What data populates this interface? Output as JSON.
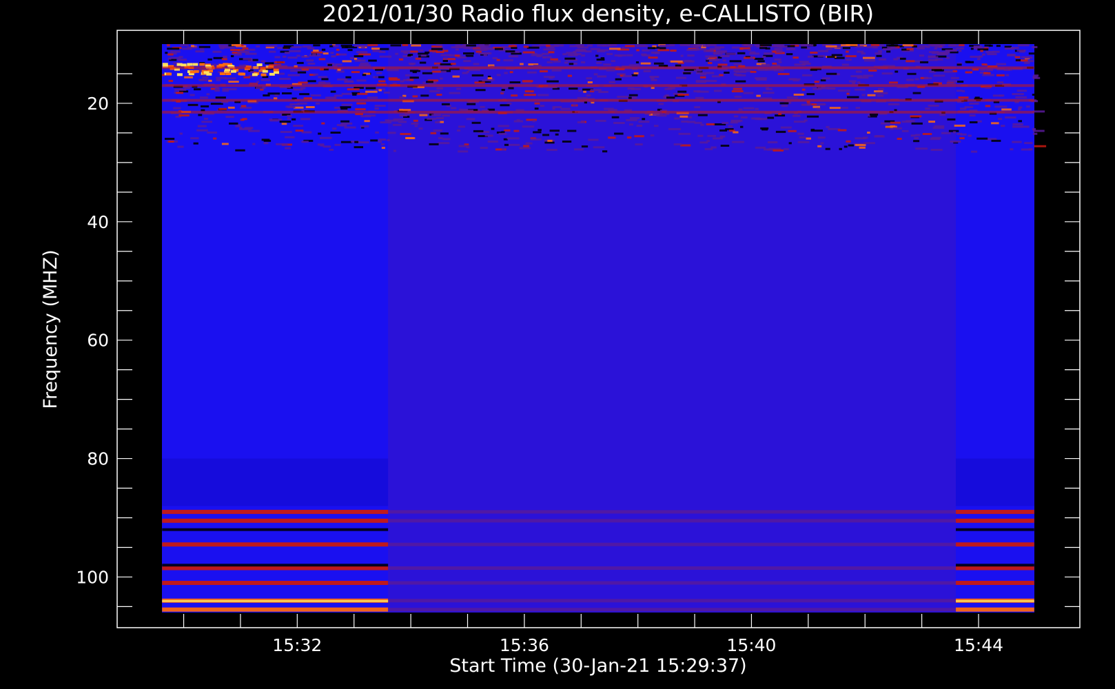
{
  "chart_data": {
    "type": "heatmap",
    "title": "2021/01/30  Radio flux density, e-CALLISTO (BIR)",
    "xlabel": "Start Time (30-Jan-21 15:29:37)",
    "ylabel": "Frequency (MHZ)",
    "x_ticks": [
      "15:32",
      "15:36",
      "15:40",
      "15:44"
    ],
    "y_ticks": [
      "20",
      "40",
      "60",
      "80",
      "100"
    ],
    "y_tick_values": [
      20,
      40,
      60,
      80,
      100
    ],
    "x_tick_minutes": [
      32,
      36,
      40,
      44
    ],
    "x_range_minutes": [
      29.617,
      44.983
    ],
    "y_range": [
      10,
      106
    ],
    "y_axis_inverted": true,
    "colormap": "black-red-orange-yellow-white over blue background",
    "segments": [
      {
        "name": "left",
        "t_start_minutes": 29.62,
        "t_end_minutes": 33.6
      },
      {
        "name": "middle",
        "t_start_minutes": 33.6,
        "t_end_minutes": 43.6
      },
      {
        "name": "right",
        "t_start_minutes": 43.6,
        "t_end_minutes": 44.98
      }
    ],
    "bright_bands_mhz": [
      14.0,
      17.0,
      19.5,
      21.5,
      89.0,
      90.5,
      94.5,
      98.5,
      101.0,
      104.0,
      105.5
    ]
  },
  "colors": {
    "background": "#000000",
    "frame": "#ffffff",
    "blue": "#1a10f0",
    "purple": "#5a1a9a",
    "red": "#c81a10",
    "orange": "#ff6a10",
    "yellow": "#ffe060",
    "white": "#ffffff"
  }
}
